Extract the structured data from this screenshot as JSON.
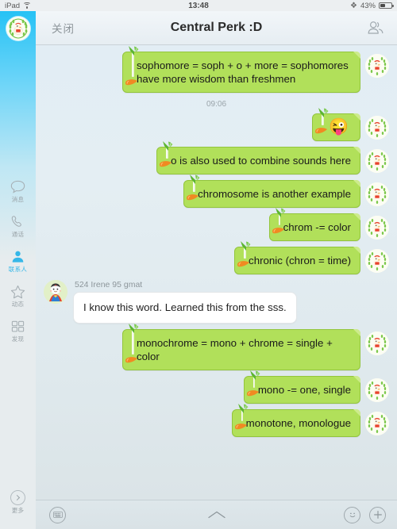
{
  "status_bar": {
    "device": "iPad",
    "wifi_icon": "wifi-icon",
    "time": "13:48",
    "bluetooth_icon": "bluetooth-icon",
    "battery_percent": "43%",
    "battery_icon": "battery-icon"
  },
  "sidebar": {
    "avatar_name": "user-avatar",
    "items": [
      {
        "label": "消息",
        "icon": "speech-bubble-icon",
        "active": false
      },
      {
        "label": "通话",
        "icon": "phone-icon",
        "active": false
      },
      {
        "label": "联系人",
        "icon": "person-icon",
        "active": true
      },
      {
        "label": "动态",
        "icon": "star-icon",
        "active": false
      },
      {
        "label": "发现",
        "icon": "grid-icon",
        "active": false
      }
    ],
    "more_label": "更多",
    "more_icon": "chevron-right-circle-icon",
    "active_color": "#35b7e8"
  },
  "header": {
    "close_label": "关闭",
    "title": "Central Perk :D",
    "members_icon": "group-members-icon"
  },
  "chat": {
    "timestamp": "09:06",
    "messages": [
      {
        "side": "out",
        "type": "text",
        "text": "sophomore = soph + o + more = sophomores have more wisdom than freshmen"
      },
      {
        "side": "out",
        "type": "emoji",
        "text": "😜"
      },
      {
        "side": "out",
        "type": "text",
        "text": "o is also used to combine sounds here"
      },
      {
        "side": "out",
        "type": "text",
        "text": "chromosome is another example"
      },
      {
        "side": "out",
        "type": "text",
        "text": "chrom -= color"
      },
      {
        "side": "out",
        "type": "text",
        "text": "chronic  (chron = time)"
      },
      {
        "side": "in",
        "type": "text",
        "sender": "524 Irene 95 gmat",
        "text": "I know this word. Learned this from the sss."
      },
      {
        "side": "out",
        "type": "text",
        "text": "monochrome = mono + chrome = single + color"
      },
      {
        "side": "out",
        "type": "text",
        "text": "mono -= one, single"
      },
      {
        "side": "out",
        "type": "text",
        "text": "monotone, monologue"
      }
    ],
    "bubble_color_out": "#b1e05a",
    "bubble_color_in": "#ffffff"
  },
  "toolbar": {
    "keyboard_icon": "keyboard-icon",
    "collapse_icon": "chevron-up-icon",
    "emoji_icon": "smiley-face-icon",
    "add_icon": "plus-icon"
  }
}
